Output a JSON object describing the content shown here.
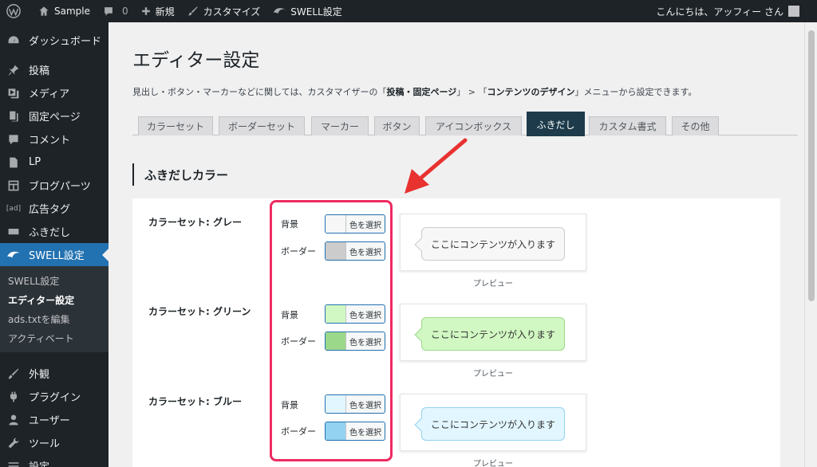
{
  "adminbar": {
    "site_name": "Sample",
    "comments_count": "0",
    "new_label": "新規",
    "customize_label": "カスタマイズ",
    "swell_label": "SWELL設定",
    "greeting": "こんにちは、アッフィー さん"
  },
  "sidebar": {
    "items": [
      {
        "label": "ダッシュボード",
        "icon": "dashboard-icon"
      },
      {
        "label": "投稿",
        "icon": "pin-icon"
      },
      {
        "label": "メディア",
        "icon": "media-icon"
      },
      {
        "label": "固定ページ",
        "icon": "page-icon"
      },
      {
        "label": "コメント",
        "icon": "comment-icon"
      },
      {
        "label": "LP",
        "icon": "document-icon"
      },
      {
        "label": "ブログパーツ",
        "icon": "layout-icon"
      },
      {
        "label": "広告タグ",
        "icon": "ad-icon",
        "icon_text": "[ad]"
      },
      {
        "label": "ふきだし",
        "icon": "bubble-icon"
      },
      {
        "label": "SWELL設定",
        "icon": "swell-icon"
      }
    ],
    "submenu": [
      {
        "label": "SWELL設定"
      },
      {
        "label": "エディター設定"
      },
      {
        "label": "ads.txtを編集"
      },
      {
        "label": "アクティベート"
      }
    ],
    "items2": [
      {
        "label": "外観",
        "icon": "brush-icon"
      },
      {
        "label": "プラグイン",
        "icon": "plugin-icon"
      },
      {
        "label": "ユーザー",
        "icon": "user-icon"
      },
      {
        "label": "ツール",
        "icon": "wrench-icon"
      },
      {
        "label": "設定",
        "icon": "settings-icon"
      }
    ]
  },
  "page": {
    "title": "エディター設定",
    "desc_prefix": "見出し・ボタン・マーカーなどに関しては、カスタマイザーの「",
    "desc_b1": "投稿・固定ページ",
    "desc_mid": "」 > 「",
    "desc_b2": "コンテンツのデザイン",
    "desc_suffix": "」メニューから設定できます。"
  },
  "tabs": [
    {
      "label": "カラーセット"
    },
    {
      "label": "ボーダーセット"
    },
    {
      "label": "マーカー"
    },
    {
      "label": "ボタン"
    },
    {
      "label": "アイコンボックス"
    },
    {
      "label": "ふきだし",
      "active": true
    },
    {
      "label": "カスタム書式"
    },
    {
      "label": "その他"
    }
  ],
  "section": {
    "title": "ふきだしカラー"
  },
  "color_sets": [
    {
      "name": "カラーセット: グレー",
      "bg_label": "背景",
      "border_label": "ボーダー",
      "bg_color": "#f7f7f7",
      "border_color": "#cccccc",
      "pick_label": "色を選択",
      "preview_text": "ここにコンテンツが入ります",
      "preview_label": "プレビュー"
    },
    {
      "name": "カラーセット: グリーン",
      "bg_label": "背景",
      "border_label": "ボーダー",
      "bg_color": "#d1f8c2",
      "border_color": "#9cd88a",
      "pick_label": "色を選択",
      "preview_text": "ここにコンテンツが入ります",
      "preview_label": "プレビュー"
    },
    {
      "name": "カラーセット: ブルー",
      "bg_label": "背景",
      "border_label": "ボーダー",
      "bg_color": "#e2f6ff",
      "border_color": "#93d2f0",
      "pick_label": "色を選択",
      "preview_text": "ここにコンテンツが入ります",
      "preview_label": "プレビュー"
    }
  ],
  "colors": {
    "accent": "#2271b1",
    "highlight": "#ee2b62",
    "tab_active": "#1d3b4a"
  }
}
